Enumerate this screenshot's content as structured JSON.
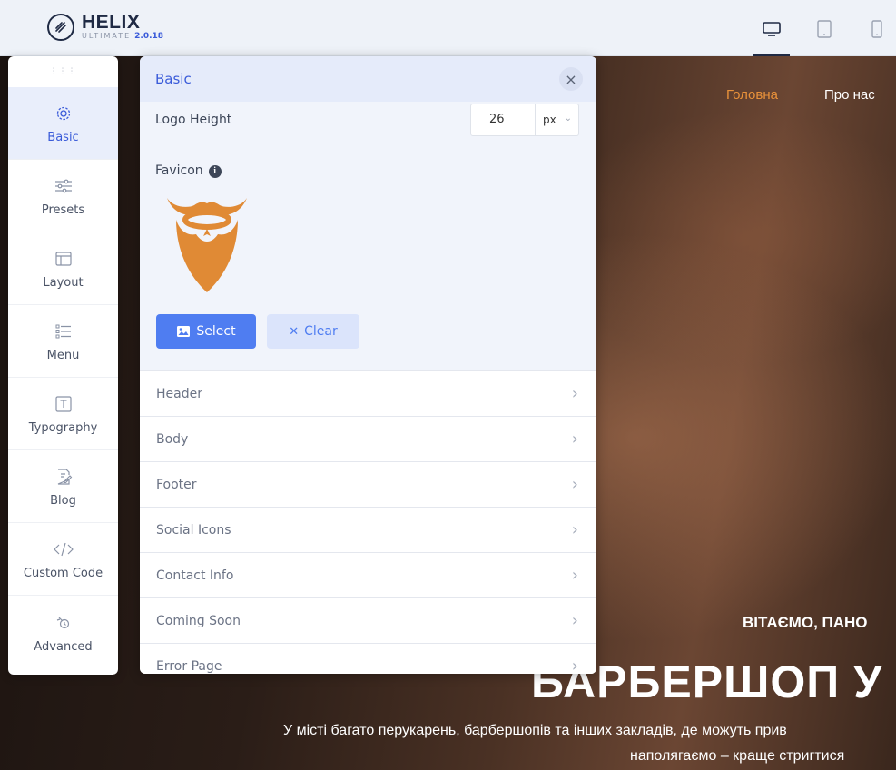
{
  "app": {
    "logo_name": "HELIX",
    "logo_sub": "ULTIMATE",
    "version": "2.0.18"
  },
  "devices": [
    {
      "name": "desktop",
      "active": true
    },
    {
      "name": "tablet",
      "active": false
    },
    {
      "name": "mobile",
      "active": false
    }
  ],
  "sidebar": {
    "items": [
      {
        "label": "Basic",
        "icon": "gear-icon",
        "active": true
      },
      {
        "label": "Presets",
        "icon": "sliders-icon",
        "active": false
      },
      {
        "label": "Layout",
        "icon": "layout-icon",
        "active": false
      },
      {
        "label": "Menu",
        "icon": "menu-icon",
        "active": false
      },
      {
        "label": "Typography",
        "icon": "typography-icon",
        "active": false
      },
      {
        "label": "Blog",
        "icon": "blog-icon",
        "active": false
      },
      {
        "label": "Custom Code",
        "icon": "code-icon",
        "active": false
      },
      {
        "label": "Advanced",
        "icon": "advanced-icon",
        "active": false
      }
    ]
  },
  "panel": {
    "title": "Basic",
    "close_glyph": "×",
    "logo_height_label": "Logo Height",
    "logo_height_value": "26",
    "logo_height_unit": "px",
    "favicon_label": "Favicon",
    "select_label": "Select",
    "clear_label": "Clear",
    "sections": [
      "Header",
      "Body",
      "Footer",
      "Social Icons",
      "Contact Info",
      "Coming Soon",
      "Error Page"
    ]
  },
  "site": {
    "nav_home": "Головна",
    "nav_about": "Про нас",
    "hero_subtitle": "ВІТАЄМО, ПАНО",
    "hero_title": "БАРБЕРШОП У",
    "hero_text_line1": "У місті багато перукарень, барбершопів та інших закладів, де можуть прив",
    "hero_text_line2": "наполягаємо – краще стригтися"
  },
  "colors": {
    "accent": "#4f7df1",
    "nav_active": "#e8913a",
    "favicon": "#e08a35",
    "panel_header": "#e5ebfa"
  }
}
